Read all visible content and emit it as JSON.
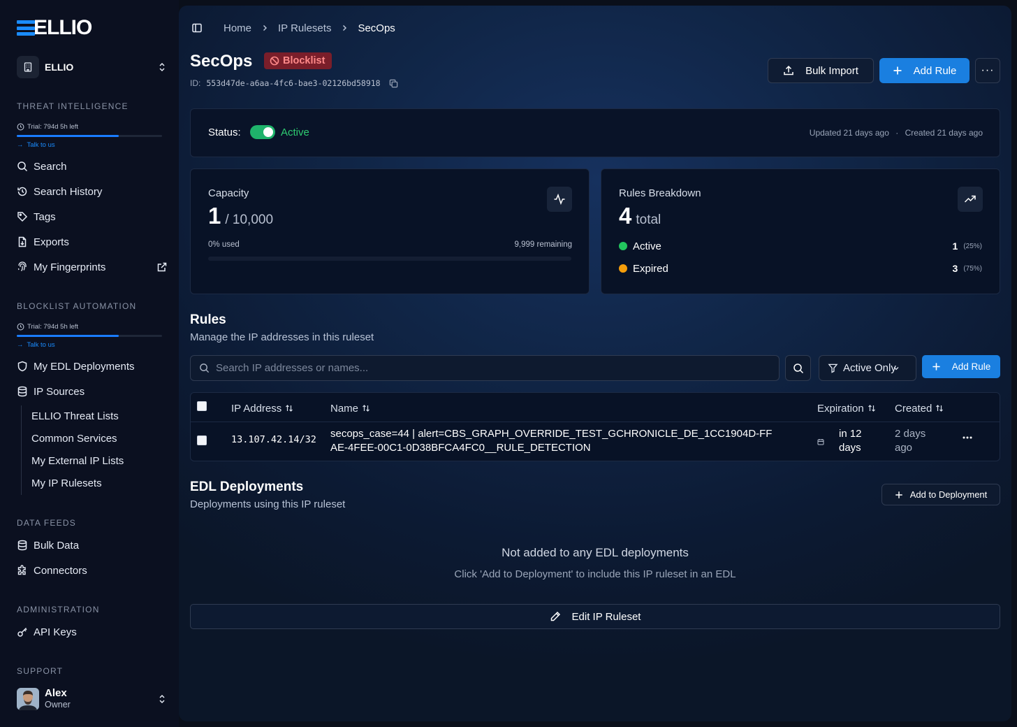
{
  "brand": {
    "logo_text": "ELLIO"
  },
  "org": {
    "name": "ELLIO"
  },
  "sections": {
    "threat_intel": "THREAT INTELLIGENCE",
    "blocklist_automation": "BLOCKLIST AUTOMATION",
    "data_feeds": "DATA FEEDS",
    "administration": "ADMINISTRATION",
    "support": "SUPPORT"
  },
  "trial": {
    "text": "Trial: 794d 5h left",
    "talk": "Talk to us",
    "progress": 0.7
  },
  "nav": {
    "search": "Search",
    "search_history": "Search History",
    "tags": "Tags",
    "exports": "Exports",
    "fingerprints": "My Fingerprints",
    "edl": "My EDL Deployments",
    "ip_sources": "IP Sources",
    "ip_sub": [
      "ELLIO Threat Lists",
      "Common Services",
      "My External IP Lists",
      "My IP Rulesets"
    ],
    "bulk_data": "Bulk Data",
    "connectors": "Connectors",
    "api_keys": "API Keys"
  },
  "user": {
    "name": "Alex",
    "role": "Owner"
  },
  "breadcrumb": [
    "Home",
    "IP Rulesets",
    "SecOps"
  ],
  "page": {
    "title": "SecOps",
    "badge": "Blocklist",
    "id_label": "ID:",
    "id_value": "553d47de-a6aa-4fc6-bae3-02126bd58918",
    "bulk_import": "Bulk Import",
    "add_rule": "Add Rule",
    "more": "···"
  },
  "status": {
    "label": "Status:",
    "value": "Active",
    "enabled": true,
    "updated": "Updated 21 days ago",
    "created": "Created 21 days ago",
    "dot": "·"
  },
  "capacity": {
    "title": "Capacity",
    "used": "1",
    "total": "/ 10,000",
    "used_pct": "0% used",
    "remaining": "9,999 remaining",
    "fraction": 0.0001
  },
  "breakdown": {
    "title": "Rules Breakdown",
    "total": "4",
    "total_label": "total",
    "items": [
      {
        "label": "Active",
        "count": "1",
        "pct": "(25%)",
        "color": "#22c55e"
      },
      {
        "label": "Expired",
        "count": "3",
        "pct": "(75%)",
        "color": "#f59e0b"
      }
    ]
  },
  "rules": {
    "title": "Rules",
    "subtitle": "Manage the IP addresses in this ruleset",
    "search_placeholder": "Search IP addresses or names...",
    "filter": "Active Only",
    "add_rule": "Add Rule",
    "columns": [
      "IP Address",
      "Name",
      "Expiration",
      "Created"
    ],
    "rows": [
      {
        "ip": "13.107.42.14/32",
        "name": "secops_case=44 | alert=CBS_GRAPH_OVERRIDE_TEST_GCHRONICLE_DE_1CC1904D-FFAE-4FEE-00C1-0D38BFCA4FC0__RULE_DETECTION",
        "expiration_1": "in 12",
        "expiration_2": "days",
        "created_1": "2 days",
        "created_2": "ago"
      }
    ]
  },
  "edl": {
    "title": "EDL Deployments",
    "subtitle": "Deployments using this IP ruleset",
    "add_button": "Add to Deployment",
    "empty_title": "Not added to any EDL deployments",
    "empty_desc": "Click 'Add to Deployment' to include this IP ruleset in an EDL"
  },
  "edit_button": "Edit IP Ruleset",
  "colors": {
    "accent": "#1a7fe0",
    "active": "#2ecc71",
    "danger": "#7a1e2a"
  }
}
